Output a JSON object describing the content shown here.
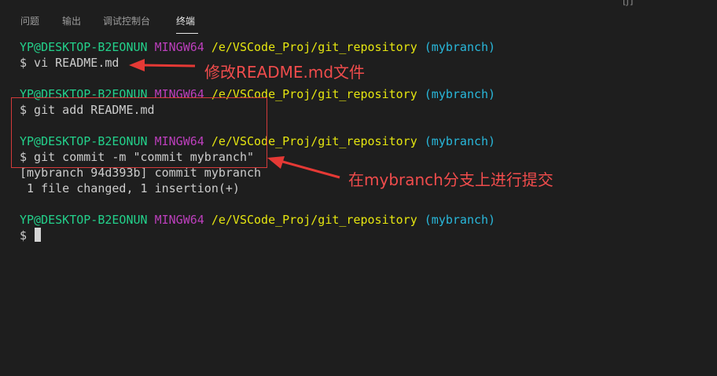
{
  "panel": {
    "tabs": [
      {
        "label": "问题",
        "active": false
      },
      {
        "label": "输出",
        "active": false
      },
      {
        "label": "调试控制台",
        "active": false
      },
      {
        "label": "终端",
        "active": true
      }
    ],
    "corner_glyph": "[ʃ]"
  },
  "terminal": {
    "prompt": {
      "user": "YP@DESKTOP-B2EONUN",
      "system": "MINGW64",
      "path": "/e/VSCode_Proj/git_repository",
      "branch": "(mybranch)"
    },
    "commands": [
      "$ vi README.md",
      "$ git add README.md",
      "$ git commit -m \"commit mybranch\""
    ],
    "output": [
      "[mybranch 94d393b] commit mybranch",
      " 1 file changed, 1 insertion(+)"
    ],
    "final_prompt": "$"
  },
  "annotations": {
    "edit_note": "修改README.md文件",
    "commit_note": "在mybranch分支上进行提交",
    "color": "#f04c4c"
  },
  "colors": {
    "background": "#1e1e1e",
    "user": "#23d18b",
    "system": "#bc3fbc",
    "path": "#e5e510",
    "branch": "#29b8db",
    "text": "#cccccc"
  }
}
